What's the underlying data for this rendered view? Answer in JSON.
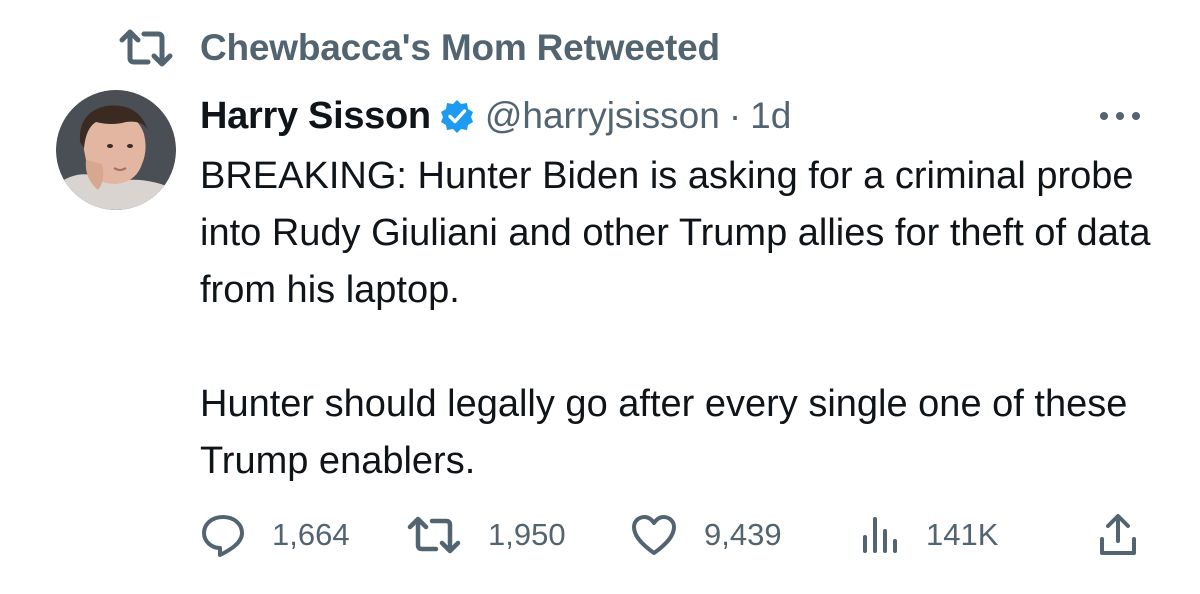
{
  "retweet_context": {
    "label": "Chewbacca's Mom Retweeted",
    "icon": "retweet-icon"
  },
  "author": {
    "display_name": "Harry Sisson",
    "verified": true,
    "verified_icon": "verified-badge-icon",
    "handle": "@harryjsisson",
    "separator": "·",
    "timestamp": "1d",
    "avatar": "avatar"
  },
  "tweet": {
    "paragraphs": [
      "BREAKING: Hunter Biden is asking for a criminal probe into Rudy Giuliani and other Trump allies for theft of data from his laptop.",
      "Hunter should legally go after every single one of these Trump enablers."
    ]
  },
  "actions": {
    "reply": {
      "icon": "reply-icon",
      "count": "1,664"
    },
    "retweet": {
      "icon": "retweet-icon",
      "count": "1,950"
    },
    "like": {
      "icon": "heart-icon",
      "count": "9,439"
    },
    "views": {
      "icon": "views-chart-icon",
      "count": "141K"
    },
    "share": {
      "icon": "share-icon"
    }
  },
  "menu": {
    "icon": "more-options-icon"
  },
  "colors": {
    "text_primary": "#0f1419",
    "text_secondary": "#536471",
    "verified_blue": "#1d9bf0",
    "background": "#ffffff"
  }
}
